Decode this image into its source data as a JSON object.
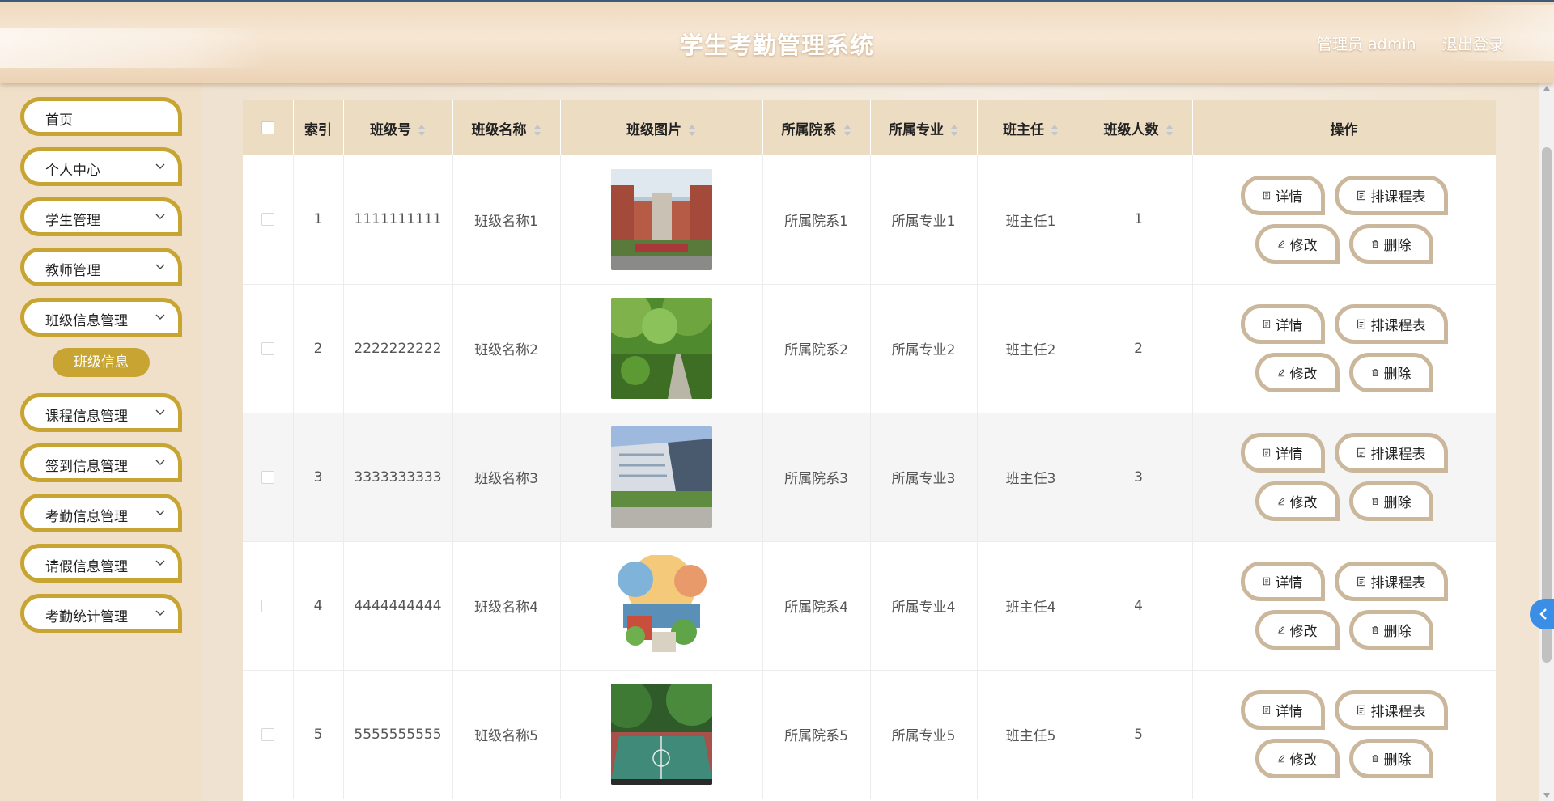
{
  "header": {
    "title": "学生考勤管理系统",
    "user_role": "管理员 admin",
    "logout_label": "退出登录"
  },
  "sidebar": {
    "items": [
      {
        "label": "首页",
        "expandable": false
      },
      {
        "label": "个人中心",
        "expandable": true
      },
      {
        "label": "学生管理",
        "expandable": true
      },
      {
        "label": "教师管理",
        "expandable": true
      },
      {
        "label": "班级信息管理",
        "expandable": true,
        "expanded": true
      },
      {
        "label": "课程信息管理",
        "expandable": true
      },
      {
        "label": "签到信息管理",
        "expandable": true
      },
      {
        "label": "考勤信息管理",
        "expandable": true
      },
      {
        "label": "请假信息管理",
        "expandable": true
      },
      {
        "label": "考勤统计管理",
        "expandable": true
      }
    ],
    "active_subitem": "班级信息"
  },
  "table": {
    "columns": [
      "索引",
      "班级号",
      "班级名称",
      "班级图片",
      "所属院系",
      "所属专业",
      "班主任",
      "班级人数",
      "操作"
    ],
    "rows": [
      {
        "index": "1",
        "class_no": "1111111111",
        "class_name": "班级名称1",
        "image": "campus-building",
        "department": "所属院系1",
        "major": "所属专业1",
        "head_teacher": "班主任1",
        "count": "1"
      },
      {
        "index": "2",
        "class_no": "2222222222",
        "class_name": "班级名称2",
        "image": "garden-path",
        "department": "所属院系2",
        "major": "所属专业2",
        "head_teacher": "班主任2",
        "count": "2"
      },
      {
        "index": "3",
        "class_no": "3333333333",
        "class_name": "班级名称3",
        "image": "modern-building",
        "department": "所属院系3",
        "major": "所属专业3",
        "head_teacher": "班主任3",
        "count": "3"
      },
      {
        "index": "4",
        "class_no": "4444444444",
        "class_name": "班级名称4",
        "image": "watercolor-campus",
        "department": "所属院系4",
        "major": "所属专业4",
        "head_teacher": "班主任4",
        "count": "4"
      },
      {
        "index": "5",
        "class_no": "5555555555",
        "class_name": "班级名称5",
        "image": "basketball-court",
        "department": "所属院系5",
        "major": "所属专业5",
        "head_teacher": "班主任5",
        "count": "5"
      }
    ],
    "actions": {
      "detail": "详情",
      "schedule": "排课程表",
      "edit": "修改",
      "delete": "删除"
    }
  },
  "colors": {
    "accent_gold": "#c8a533",
    "button_border": "#cbb79b",
    "header_row": "#ecdcc2",
    "toggle_blue": "#3b8ee6"
  }
}
